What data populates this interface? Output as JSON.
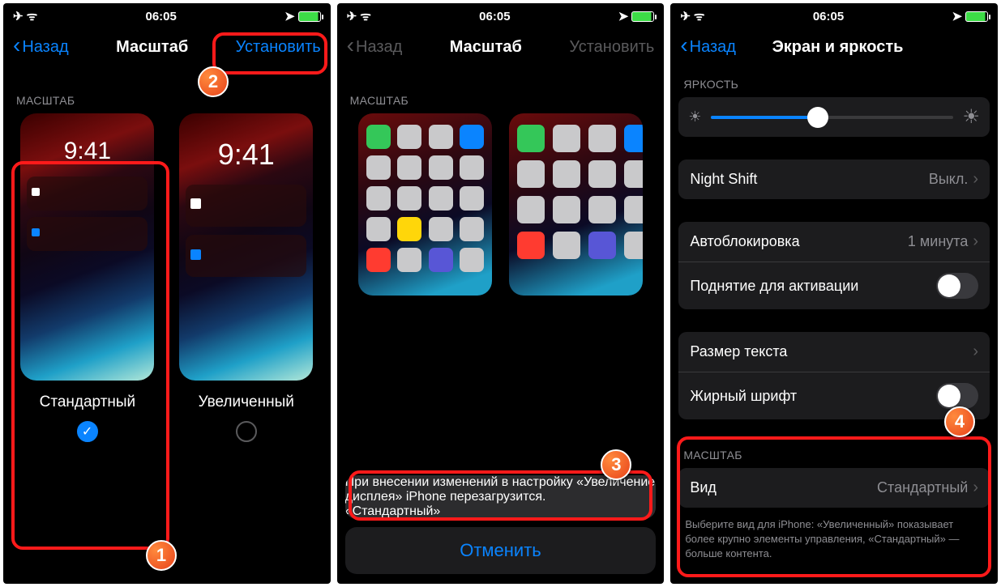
{
  "status": {
    "time": "06:05"
  },
  "panel1": {
    "back": "Назад",
    "title": "Масштаб",
    "set": "Установить",
    "section": "МАСШТАБ",
    "previewTime": "9:41",
    "standard": "Стандартный",
    "enlarged": "Увеличенный"
  },
  "panel2": {
    "back": "Назад",
    "title": "Масштаб",
    "set": "Установить",
    "section": "МАСШТАБ",
    "sheetMsg": "При внесении изменений в настройку «Увеличение дисплея» iPhone перезагрузится.",
    "confirm": "«Стандартный»",
    "cancel": "Отменить"
  },
  "panel3": {
    "back": "Назад",
    "title": "Экран и яркость",
    "brightnessLabel": "ЯРКОСТЬ",
    "nightShift": "Night Shift",
    "nightShiftVal": "Выкл.",
    "autolock": "Автоблокировка",
    "autolockVal": "1 минута",
    "raise": "Поднятие для активации",
    "textSize": "Размер текста",
    "bold": "Жирный шрифт",
    "zoomSection": "МАСШТАБ",
    "view": "Вид",
    "viewVal": "Стандартный",
    "footer": "Выберите вид для iPhone: «Увеличенный» показывает более крупно элементы управления, «Стандартный» — больше контента."
  },
  "markers": {
    "m1": "1",
    "m2": "2",
    "m3": "3",
    "m4": "4"
  }
}
